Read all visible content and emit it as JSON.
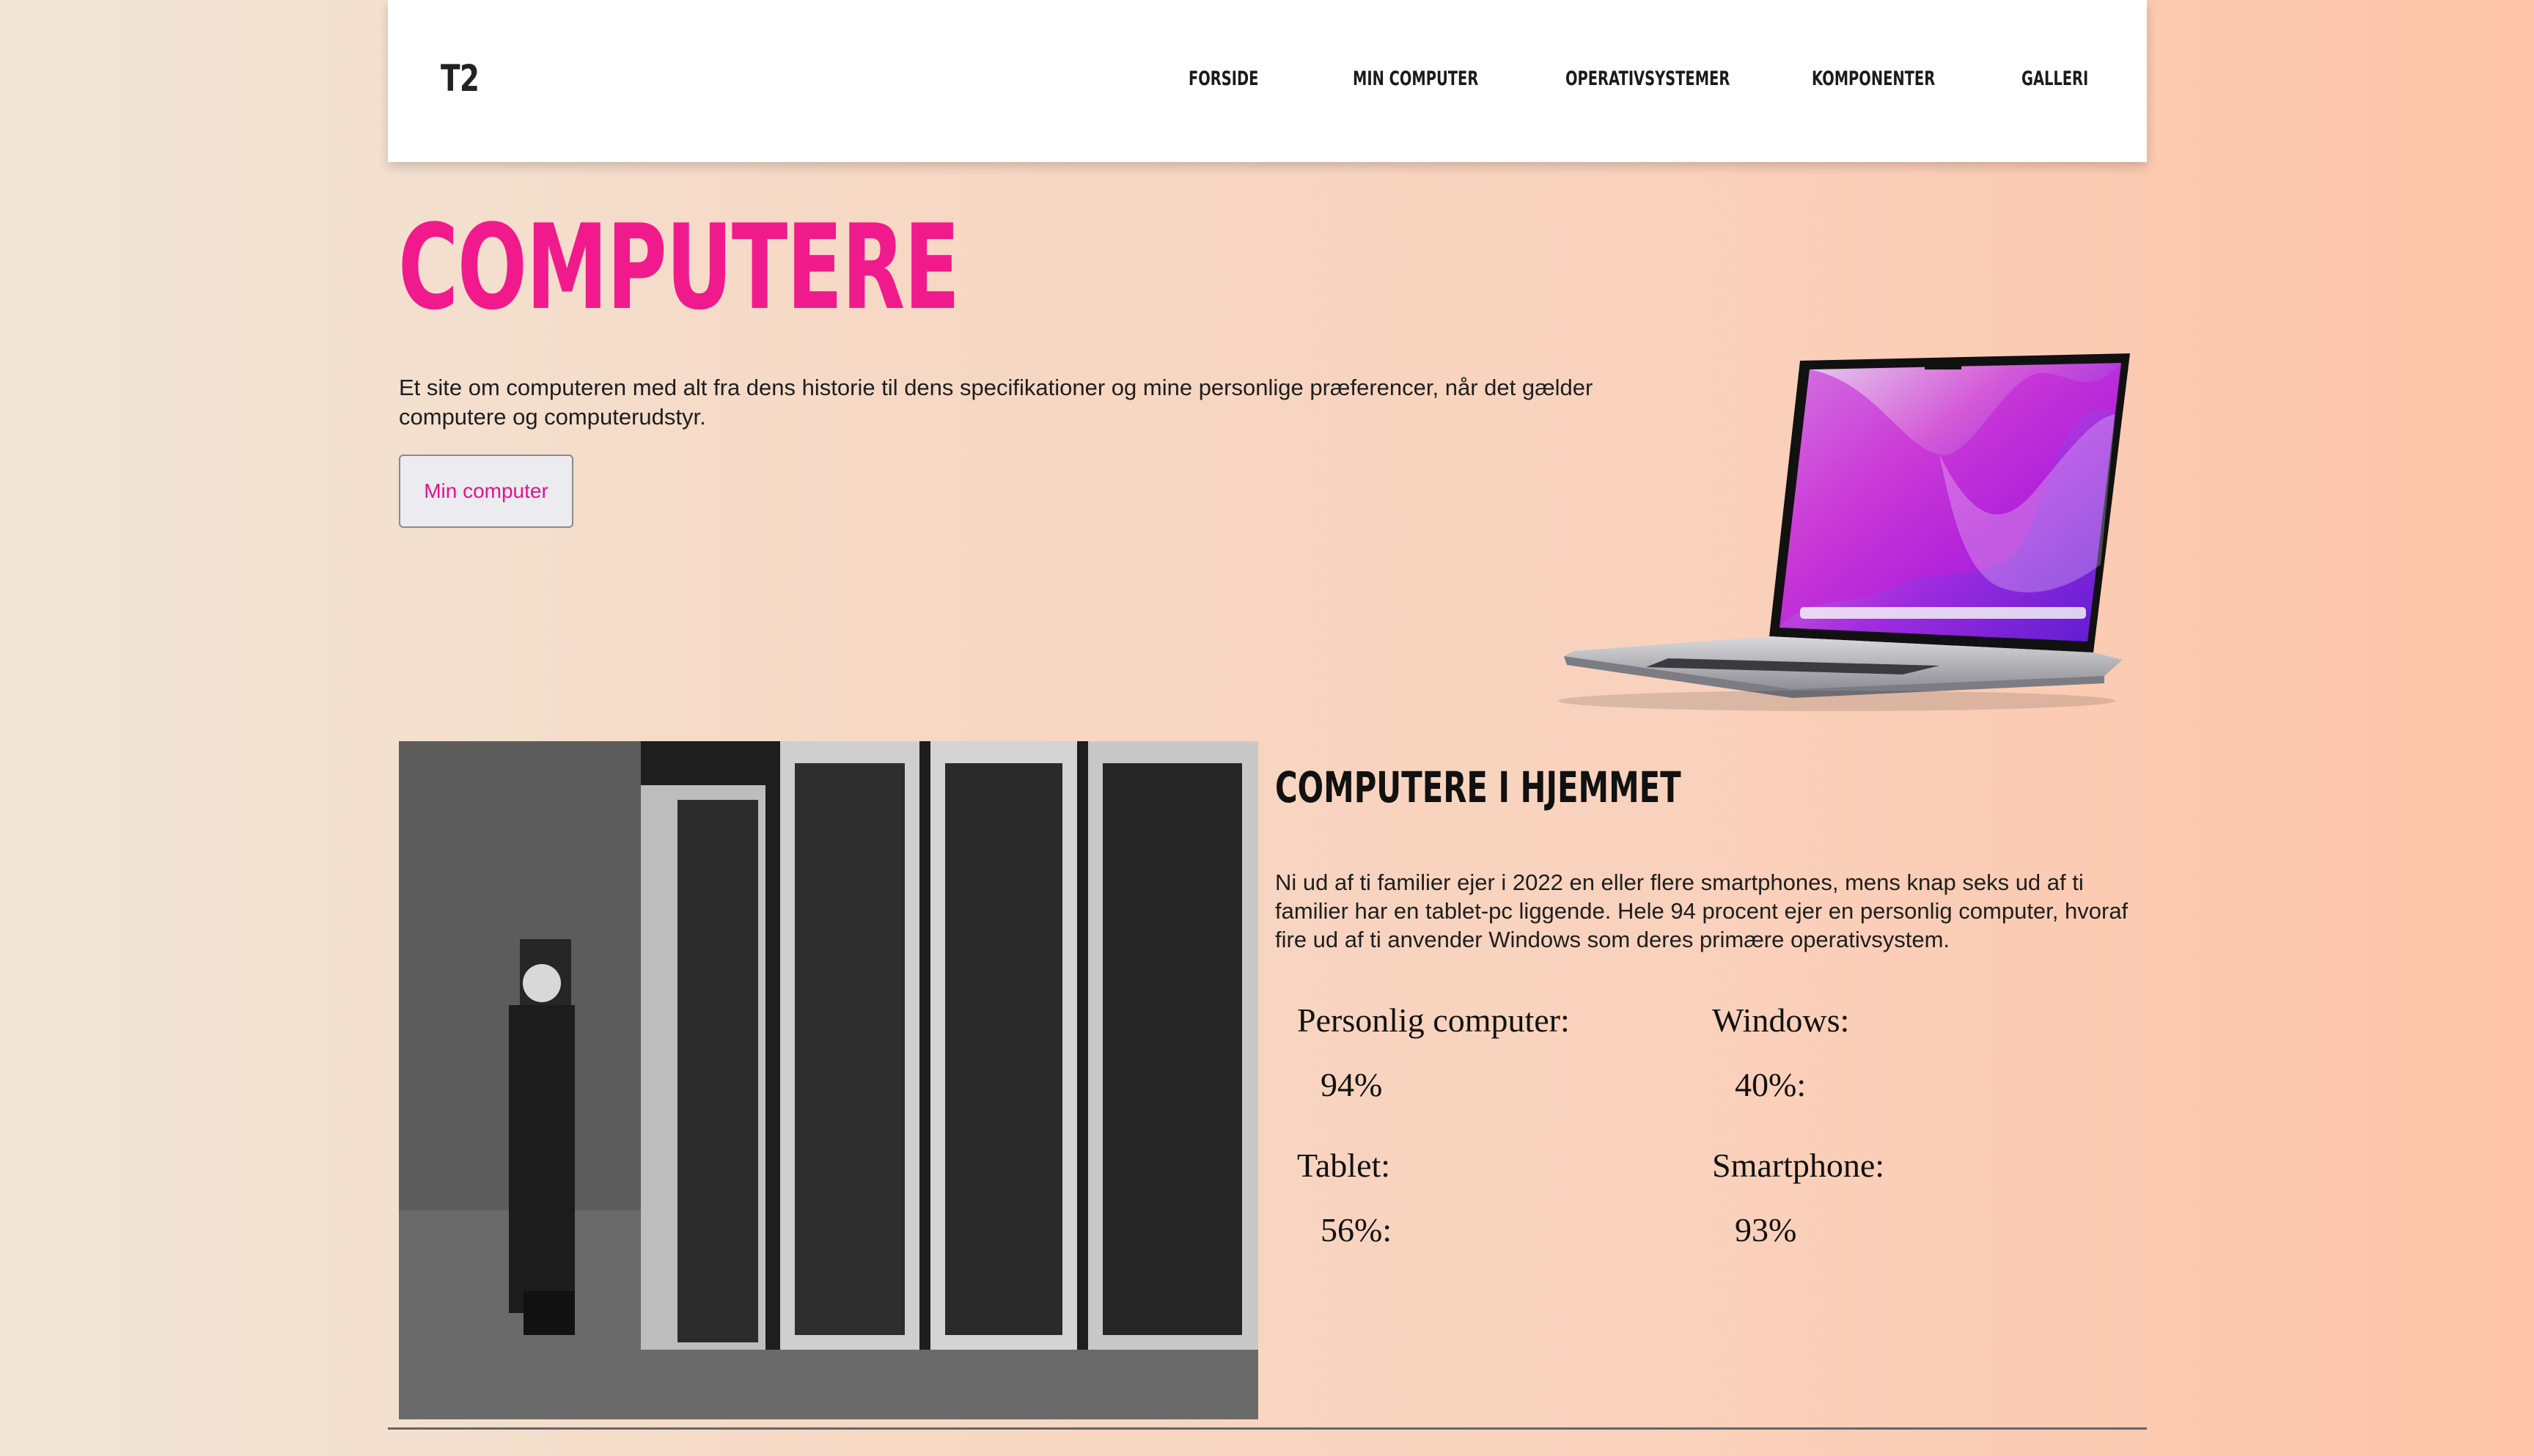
{
  "header": {
    "logo": "T2",
    "nav": [
      "FORSIDE",
      "MIN COMPUTER",
      "OPERATIVSYSTEMER",
      "KOMPONENTER",
      "GALLERI"
    ]
  },
  "hero": {
    "title": "COMPUTERE",
    "text": "Et site om computeren med alt fra dens historie til dens specifikationer og mine personlige præferencer, når det gælder computere og computerudstyr.",
    "button": "Min computer"
  },
  "section": {
    "title": "COMPUTERE I HJEMMET",
    "text": "Ni ud af ti familier ejer i 2022 en eller flere smartphones, mens knap seks ud af ti familier har en tablet-pc liggende. Hele 94 procent ejer en personlig computer, hvoraf fire ud af ti anvender Windows som deres primære operativsystem.",
    "stats": [
      {
        "label": "Personlig computer:",
        "value": "94%"
      },
      {
        "label": "Windows:",
        "value": "40%:"
      },
      {
        "label": "Tablet:",
        "value": "56%:"
      },
      {
        "label": "Smartphone:",
        "value": "93%"
      }
    ]
  },
  "colors": {
    "accent": "#f01a8c",
    "header_bg": "#ffffff"
  }
}
